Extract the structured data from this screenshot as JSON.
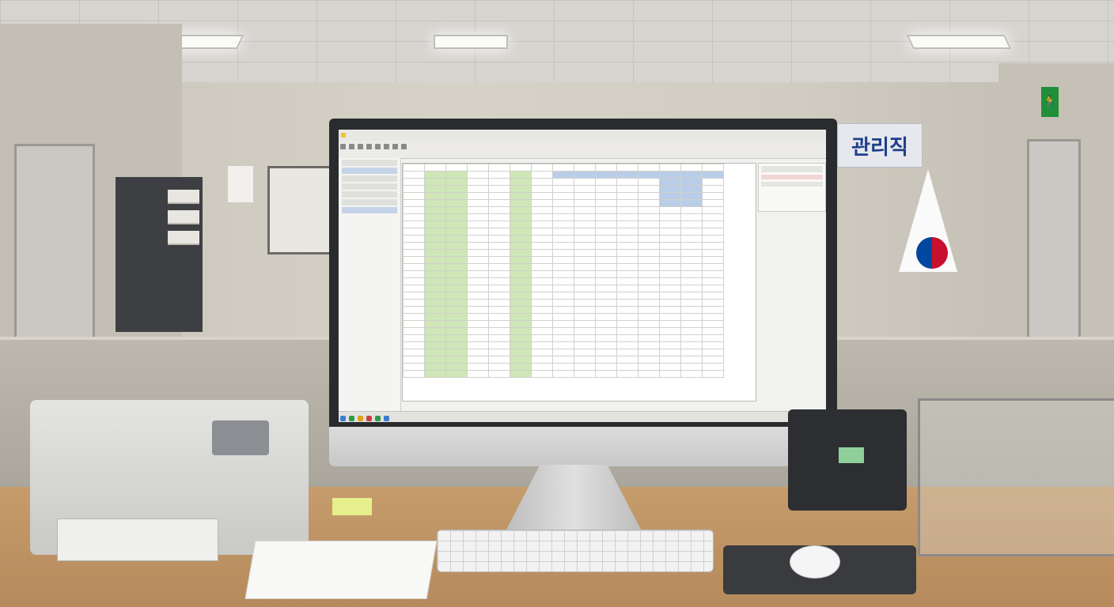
{
  "scene": {
    "wall_sign_text": "관리직",
    "colors": {
      "sheet_green": "#cfe6b6",
      "sheet_blue": "#b9cde8",
      "text_red": "#b02020"
    },
    "icons": [
      "exit-sign-icon",
      "flag-icon"
    ]
  },
  "spreadsheet": {
    "rows": [
      [
        "",
        "",
        "",
        "",
        "",
        "",
        "",
        "",
        "",
        "",
        "",
        "",
        "",
        "",
        ""
      ]
    ]
  }
}
